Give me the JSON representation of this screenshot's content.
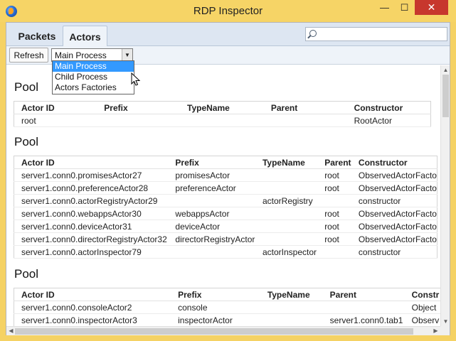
{
  "window": {
    "title": "RDP Inspector",
    "min_icon": "minimize-icon",
    "max_icon": "maximize-icon",
    "close_icon": "close-icon",
    "min_glyph": "—",
    "max_glyph": "☐",
    "close_glyph": "✕"
  },
  "tabs": [
    {
      "label": "Packets"
    },
    {
      "label": "Actors"
    }
  ],
  "search": {
    "placeholder": "",
    "value": ""
  },
  "toolbar": {
    "refresh_label": "Refresh",
    "process_selected": "Main Process"
  },
  "dropdown": {
    "options": [
      "Main Process",
      "Child Process",
      "Actors Factories"
    ]
  },
  "pools": [
    {
      "title": "Pool",
      "columns": [
        "Actor ID",
        "Prefix",
        "TypeName",
        "Parent",
        "Constructor"
      ],
      "rows": [
        [
          "root",
          "",
          "",
          "",
          "RootActor"
        ]
      ]
    },
    {
      "title": "Pool",
      "columns": [
        "Actor ID",
        "Prefix",
        "TypeName",
        "Parent",
        "Constructor"
      ],
      "rows": [
        [
          "server1.conn0.promisesActor27",
          "promisesActor",
          "",
          "root",
          "ObservedActorFacto"
        ],
        [
          "server1.conn0.preferenceActor28",
          "preferenceActor",
          "",
          "root",
          "ObservedActorFacto"
        ],
        [
          "server1.conn0.actorRegistryActor29",
          "",
          "actorRegistry",
          "",
          "constructor"
        ],
        [
          "server1.conn0.webappsActor30",
          "webappsActor",
          "",
          "root",
          "ObservedActorFacto"
        ],
        [
          "server1.conn0.deviceActor31",
          "deviceActor",
          "",
          "root",
          "ObservedActorFacto"
        ],
        [
          "server1.conn0.directorRegistryActor32",
          "directorRegistryActor",
          "",
          "root",
          "ObservedActorFacto"
        ],
        [
          "server1.conn0.actorInspector79",
          "",
          "actorInspector",
          "",
          "constructor"
        ]
      ]
    },
    {
      "title": "Pool",
      "columns": [
        "Actor ID",
        "Prefix",
        "TypeName",
        "Parent",
        "Constr"
      ],
      "rows": [
        [
          "server1.conn0.consoleActor2",
          "console",
          "",
          "",
          "Object"
        ],
        [
          "server1.conn0.inspectorActor3",
          "inspectorActor",
          "",
          "server1.conn0.tab1",
          "Observ"
        ]
      ]
    }
  ]
}
